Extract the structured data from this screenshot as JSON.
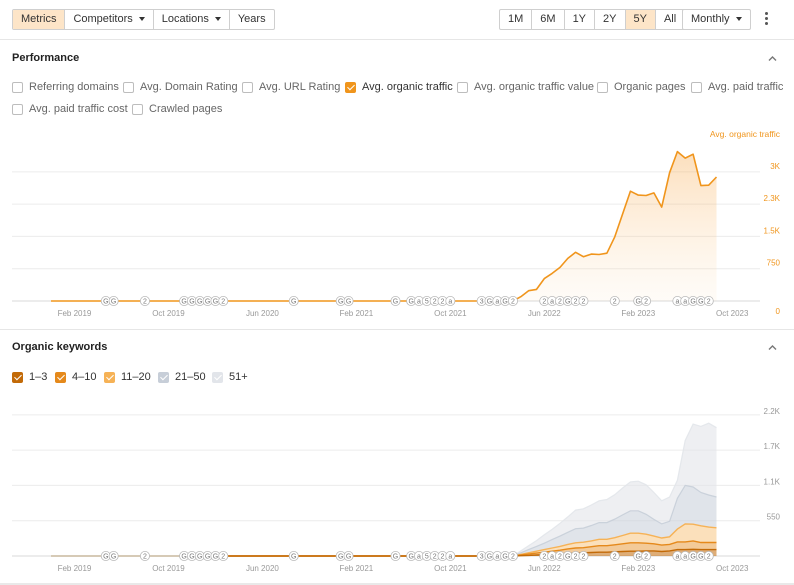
{
  "toolbar": {
    "tabs": [
      {
        "label": "Metrics",
        "active": true
      },
      {
        "label": "Competitors",
        "caret": true
      },
      {
        "label": "Locations",
        "caret": true
      },
      {
        "label": "Years"
      }
    ],
    "ranges": [
      {
        "label": "1M"
      },
      {
        "label": "6M"
      },
      {
        "label": "1Y"
      },
      {
        "label": "2Y"
      },
      {
        "label": "5Y",
        "active": true
      },
      {
        "label": "All"
      }
    ],
    "interval": "Monthly"
  },
  "performance": {
    "title": "Performance",
    "checkboxes": [
      {
        "label": "Referring domains",
        "checked": false
      },
      {
        "label": "Avg. Domain Rating",
        "checked": false
      },
      {
        "label": "Avg. URL Rating",
        "checked": false
      },
      {
        "label": "Avg. organic traffic",
        "checked": true
      },
      {
        "label": "Avg. organic traffic value",
        "checked": false
      },
      {
        "label": "Organic pages",
        "checked": false
      },
      {
        "label": "Avg. paid traffic",
        "checked": false
      },
      {
        "label": "Avg. paid traffic cost",
        "checked": false
      },
      {
        "label": "Crawled pages",
        "checked": false
      }
    ],
    "accent": "#f0951c"
  },
  "keywords": {
    "title": "Organic keywords",
    "checkboxes": [
      {
        "label": "1–3",
        "checked": true,
        "color": "#c26a08"
      },
      {
        "label": "4–10",
        "checked": true,
        "color": "#e5891b"
      },
      {
        "label": "11–20",
        "checked": true,
        "color": "#f6b256"
      },
      {
        "label": "21–50",
        "checked": true,
        "color": "#c7ced8"
      },
      {
        "label": "51+",
        "checked": true,
        "color": "#e2e5ea"
      }
    ]
  },
  "chart_data": [
    {
      "type": "area",
      "series": [
        {
          "name": "Avg. organic traffic",
          "color": "#f0951c",
          "values": [
            0,
            0,
            0,
            0,
            0,
            0,
            0,
            0,
            0,
            0,
            0,
            0,
            0,
            0,
            0,
            0,
            0,
            0,
            0,
            0,
            0,
            0,
            0,
            0,
            0,
            0,
            0,
            0,
            0,
            0,
            0,
            0,
            0,
            0,
            0,
            0,
            0,
            0,
            0,
            0,
            100,
            240,
            270,
            520,
            640,
            780,
            990,
            1130,
            1030,
            1090,
            1080,
            1110,
            1490,
            2020,
            2550,
            2460,
            2450,
            2510,
            2180,
            2980,
            3470,
            3320,
            3410,
            2680,
            2690,
            2880
          ]
        }
      ],
      "ylim": [
        0,
        3600
      ],
      "y_ticks": [
        "0",
        "750",
        "1.5K",
        "2.3K",
        "3K"
      ],
      "x_ticks": [
        "Feb 2019",
        "Oct 2019",
        "Jun 2020",
        "Feb 2021",
        "Oct 2021",
        "Jun 2022",
        "Feb 2023",
        "Oct 2023"
      ],
      "grid": true
    },
    {
      "type": "area",
      "stacked": true,
      "series": [
        {
          "name": "1–3",
          "color": "#c26a08",
          "values": [
            0,
            0,
            0,
            0,
            0,
            0,
            0,
            0,
            0,
            0,
            0,
            0,
            0,
            0,
            0,
            0,
            0,
            0,
            0,
            0,
            0,
            0,
            0,
            0,
            0,
            0,
            0,
            0,
            0,
            0,
            0,
            0,
            0,
            0,
            0,
            0,
            0,
            0,
            0,
            0,
            5,
            10,
            15,
            20,
            25,
            30,
            40,
            45,
            50,
            55,
            60,
            60,
            65,
            70,
            75,
            75,
            80,
            80,
            70,
            80,
            100,
            100,
            105,
            100,
            100,
            100
          ]
        },
        {
          "name": "4–10",
          "color": "#e5891b",
          "values": [
            0,
            0,
            0,
            0,
            0,
            0,
            0,
            0,
            0,
            0,
            0,
            0,
            0,
            0,
            0,
            0,
            0,
            0,
            0,
            0,
            0,
            0,
            0,
            0,
            0,
            0,
            0,
            0,
            0,
            0,
            0,
            0,
            0,
            0,
            0,
            0,
            0,
            0,
            0,
            0,
            10,
            20,
            30,
            40,
            50,
            60,
            70,
            80,
            80,
            90,
            100,
            100,
            110,
            120,
            130,
            130,
            120,
            110,
            100,
            100,
            120,
            120,
            130,
            110,
            110,
            110
          ]
        },
        {
          "name": "11–20",
          "color": "#f6b256",
          "values": [
            0,
            0,
            0,
            0,
            0,
            0,
            0,
            0,
            0,
            0,
            0,
            0,
            0,
            0,
            0,
            0,
            0,
            0,
            0,
            0,
            0,
            0,
            0,
            0,
            0,
            0,
            0,
            0,
            0,
            0,
            0,
            0,
            0,
            0,
            0,
            0,
            0,
            0,
            0,
            0,
            10,
            20,
            30,
            40,
            50,
            60,
            70,
            80,
            85,
            90,
            100,
            100,
            110,
            130,
            150,
            150,
            140,
            120,
            110,
            120,
            200,
            280,
            260,
            260,
            240,
            230
          ]
        },
        {
          "name": "21–50",
          "color": "#c7ced8",
          "values": [
            0,
            0,
            0,
            0,
            0,
            0,
            0,
            0,
            0,
            0,
            0,
            0,
            0,
            0,
            0,
            0,
            0,
            0,
            0,
            0,
            0,
            0,
            0,
            0,
            0,
            0,
            0,
            0,
            0,
            0,
            0,
            0,
            0,
            0,
            0,
            0,
            0,
            0,
            0,
            0,
            25,
            50,
            75,
            100,
            130,
            160,
            190,
            220,
            220,
            240,
            260,
            260,
            290,
            320,
            350,
            350,
            310,
            260,
            220,
            240,
            480,
            600,
            580,
            520,
            500,
            480
          ]
        },
        {
          "name": "51+",
          "color": "#e2e5ea",
          "values": [
            0,
            0,
            0,
            0,
            0,
            0,
            0,
            0,
            0,
            0,
            0,
            0,
            0,
            0,
            0,
            0,
            0,
            0,
            0,
            0,
            0,
            0,
            0,
            0,
            0,
            0,
            0,
            0,
            0,
            0,
            0,
            0,
            0,
            0,
            0,
            0,
            0,
            0,
            0,
            0,
            30,
            60,
            90,
            130,
            160,
            200,
            240,
            290,
            300,
            320,
            340,
            360,
            380,
            420,
            450,
            460,
            460,
            420,
            360,
            380,
            280,
            700,
            980,
            1030,
            1120,
            1080
          ]
        }
      ],
      "ylim": [
        0,
        2400
      ],
      "y_ticks": [
        "550",
        "1.1K",
        "1.7K",
        "2.2K"
      ],
      "x_ticks": [
        "Feb 2019",
        "Oct 2019",
        "Jun 2020",
        "Feb 2021",
        "Oct 2021",
        "Jun 2022",
        "Feb 2023",
        "Oct 2023"
      ],
      "grid": true
    }
  ],
  "annotations": {
    "chart1": [
      {
        "label": "G",
        "month": 7
      },
      {
        "label": "G",
        "month": 8
      },
      {
        "label": "2",
        "month": 12
      },
      {
        "label": "G",
        "month": 17
      },
      {
        "label": "G",
        "month": 18
      },
      {
        "label": "G",
        "month": 19
      },
      {
        "label": "G",
        "month": 20
      },
      {
        "label": "G",
        "month": 21
      },
      {
        "label": "2",
        "month": 22
      },
      {
        "label": "G",
        "month": 31
      },
      {
        "label": "G",
        "month": 37
      },
      {
        "label": "G",
        "month": 38
      },
      {
        "label": "G",
        "month": 44
      },
      {
        "label": "G",
        "month": 46
      },
      {
        "label": "a",
        "month": 47
      },
      {
        "label": "5",
        "month": 48
      },
      {
        "label": "2",
        "month": 49
      },
      {
        "label": "2",
        "month": 50
      },
      {
        "label": "a",
        "month": 51
      },
      {
        "label": "3",
        "month": 55
      },
      {
        "label": "G",
        "month": 56
      },
      {
        "label": "a",
        "month": 57
      },
      {
        "label": "G",
        "month": 58
      },
      {
        "label": "2",
        "month": 59
      },
      {
        "label": "2",
        "month": 63
      },
      {
        "label": "a",
        "month": 64
      },
      {
        "label": "2",
        "month": 65
      },
      {
        "label": "G",
        "month": 66
      },
      {
        "label": "2",
        "month": 67
      },
      {
        "label": "2",
        "month": 68
      },
      {
        "label": "2",
        "month": 72
      },
      {
        "label": "G",
        "month": 75
      },
      {
        "label": "2",
        "month": 76
      },
      {
        "label": "a",
        "month": 80
      },
      {
        "label": "a",
        "month": 81
      },
      {
        "label": "G",
        "month": 82
      },
      {
        "label": "G",
        "month": 83
      },
      {
        "label": "2",
        "month": 84
      }
    ],
    "chart2": [
      {
        "label": "G",
        "month": 7
      },
      {
        "label": "G",
        "month": 8
      },
      {
        "label": "2",
        "month": 12
      },
      {
        "label": "G",
        "month": 17
      },
      {
        "label": "G",
        "month": 18
      },
      {
        "label": "G",
        "month": 19
      },
      {
        "label": "G",
        "month": 20
      },
      {
        "label": "G",
        "month": 21
      },
      {
        "label": "2",
        "month": 22
      },
      {
        "label": "G",
        "month": 31
      },
      {
        "label": "G",
        "month": 37
      },
      {
        "label": "G",
        "month": 38
      },
      {
        "label": "G",
        "month": 44
      },
      {
        "label": "G",
        "month": 46
      },
      {
        "label": "a",
        "month": 47
      },
      {
        "label": "5",
        "month": 48
      },
      {
        "label": "2",
        "month": 49
      },
      {
        "label": "2",
        "month": 50
      },
      {
        "label": "a",
        "month": 51
      },
      {
        "label": "3",
        "month": 55
      },
      {
        "label": "G",
        "month": 56
      },
      {
        "label": "a",
        "month": 57
      },
      {
        "label": "G",
        "month": 58
      },
      {
        "label": "2",
        "month": 59
      },
      {
        "label": "2",
        "month": 63
      },
      {
        "label": "a",
        "month": 64
      },
      {
        "label": "2",
        "month": 65
      },
      {
        "label": "G",
        "month": 66
      },
      {
        "label": "2",
        "month": 67
      },
      {
        "label": "2",
        "month": 68
      },
      {
        "label": "2",
        "month": 72
      },
      {
        "label": "G",
        "month": 75
      },
      {
        "label": "2",
        "month": 76
      },
      {
        "label": "a",
        "month": 80
      },
      {
        "label": "a",
        "month": 81
      },
      {
        "label": "G",
        "month": 82
      },
      {
        "label": "G",
        "month": 83
      },
      {
        "label": "2",
        "month": 84
      }
    ]
  }
}
